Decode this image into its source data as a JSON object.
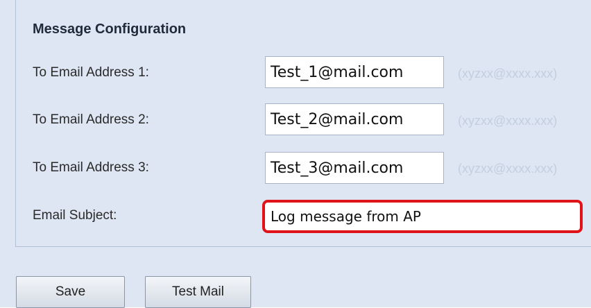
{
  "section": {
    "title": "Message Configuration"
  },
  "fields": [
    {
      "label": "To Email Address 1:",
      "value": "Test_1@mail.com",
      "hint": "(xyzxx@xxxx.xxx)"
    },
    {
      "label": "To Email Address 2:",
      "value": "Test_2@mail.com",
      "hint": "(xyzxx@xxxx.xxx)"
    },
    {
      "label": "To Email Address 3:",
      "value": "Test_3@mail.com",
      "hint": "(xyzxx@xxxx.xxx)"
    }
  ],
  "subject": {
    "label": "Email Subject:",
    "value": "Log message from AP"
  },
  "buttons": {
    "save": "Save",
    "test_mail": "Test Mail"
  },
  "colors": {
    "highlight": "#e0121a",
    "panel": "#dde6f2"
  }
}
